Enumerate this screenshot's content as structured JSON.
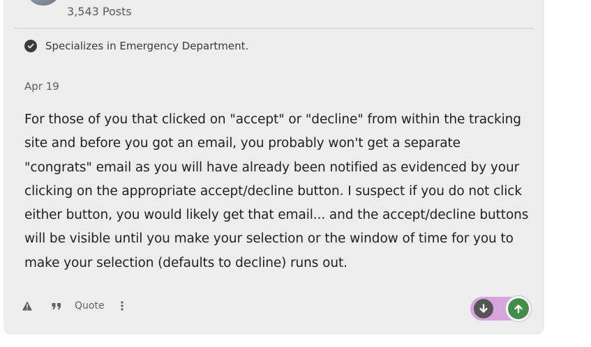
{
  "author": {
    "post_count": "3,543 Posts",
    "specialty": "Specializes in Emergency Department."
  },
  "post": {
    "date": "Apr 19",
    "body": "For those of you that clicked on \"accept\" or \"decline\" from within the tracking site and before you got an email, you probably won't get a separate \"congrats\" email as you will have already been notified as evidenced by your clicking on the appropriate accept/decline button. I suspect if you do not click either button, you would likely get that email... and the accept/decline buttons will be visible until you make your selection or the window of time for you to make your selection (defaults to decline) runs out."
  },
  "actions": {
    "quote_label": "Quote",
    "icons": [
      "warning-icon",
      "quote-icon",
      "more-icon"
    ]
  },
  "vote": {
    "pill_color": "#d9a3dd",
    "upvote_color": "#3f8f4a",
    "downvote_color": "#555555"
  }
}
